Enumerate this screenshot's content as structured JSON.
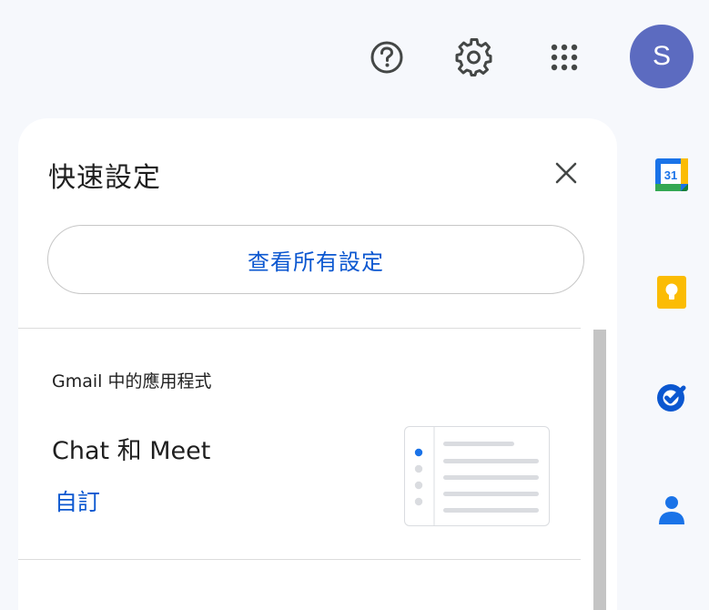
{
  "header": {
    "help_icon": "help-circle-icon",
    "settings_icon": "gear-icon",
    "apps_icon": "apps-grid-icon",
    "avatar_letter": "S",
    "avatar_color": "#5c6bc0"
  },
  "quick_settings": {
    "title": "快速設定",
    "close_icon": "close-icon",
    "view_all_label": "查看所有設定",
    "apps_section_label": "Gmail 中的應用程式",
    "chat_meet_label": "Chat 和 Meet",
    "customize_label": "自訂"
  },
  "side_panel": {
    "apps": [
      {
        "name": "calendar",
        "icon": "calendar-icon",
        "text": "31"
      },
      {
        "name": "keep",
        "icon": "keep-icon"
      },
      {
        "name": "tasks",
        "icon": "tasks-icon"
      },
      {
        "name": "contacts",
        "icon": "contacts-icon"
      }
    ]
  },
  "colors": {
    "accent_blue": "#0b57d0",
    "avatar": "#5c6bc0",
    "calendar_blue": "#1a73e8",
    "keep_yellow": "#fbbc04",
    "tasks_blue": "#0b57d0",
    "contacts_blue": "#1a73e8"
  }
}
